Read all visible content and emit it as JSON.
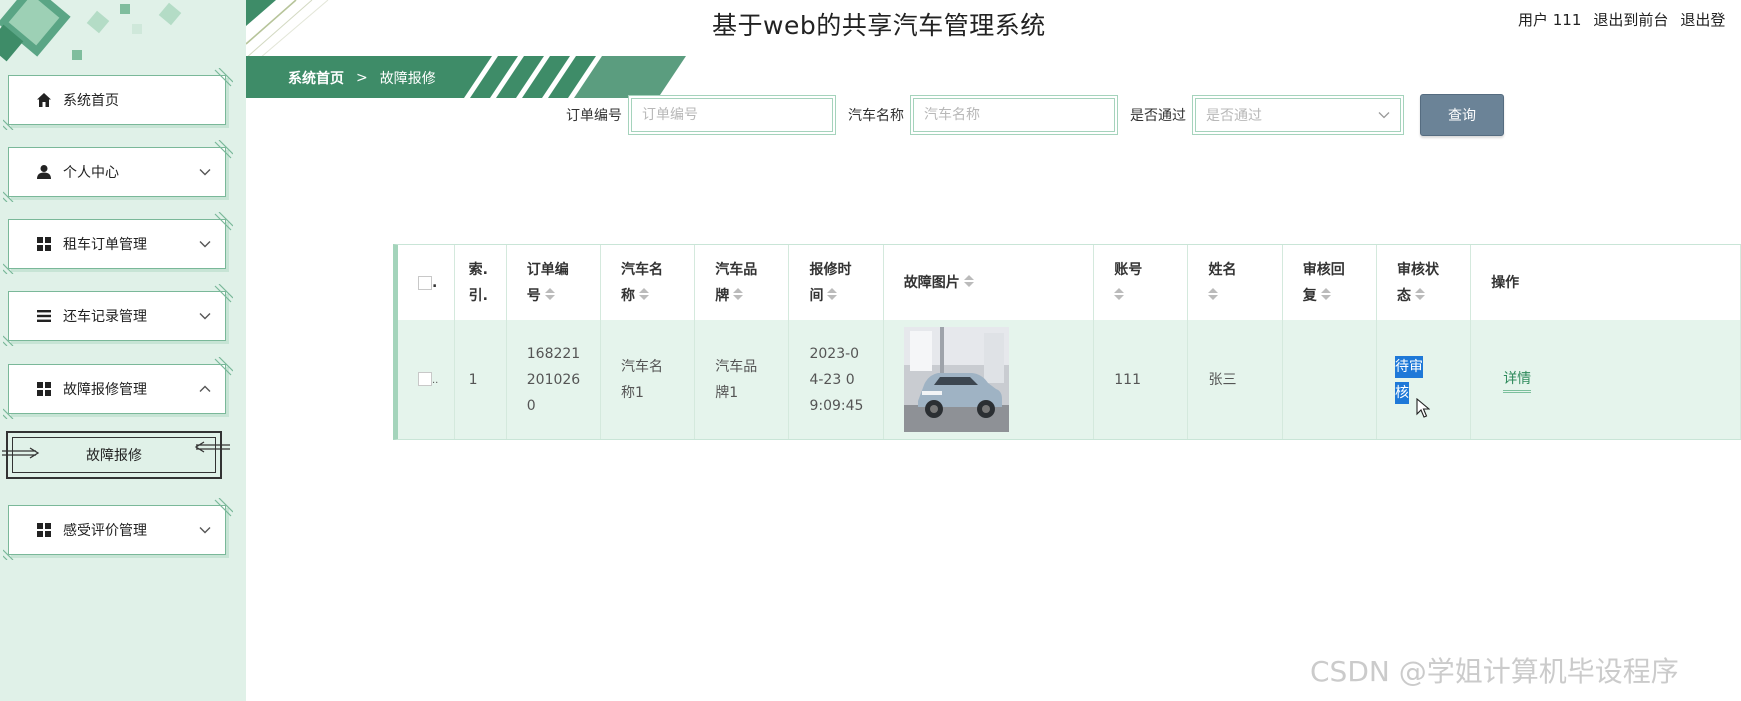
{
  "header": {
    "title": "基于web的共享汽车管理系统",
    "user_label": "用户 111",
    "to_front_label": "退出到前台",
    "logout_label": "退出登"
  },
  "breadcrumb": {
    "home": "系统首页",
    "separator": ">",
    "current": "故障报修"
  },
  "sidebar": {
    "items": [
      {
        "label": "系统首页",
        "icon": "home-icon"
      },
      {
        "label": "个人中心",
        "icon": "user-icon"
      },
      {
        "label": "租车订单管理",
        "icon": "grid-icon"
      },
      {
        "label": "还车记录管理",
        "icon": "list-icon"
      },
      {
        "label": "故障报修管理",
        "icon": "grid-icon"
      },
      {
        "label": "感受评价管理",
        "icon": "grid-icon"
      }
    ],
    "active_sub": "故障报修"
  },
  "search": {
    "order_label": "订单编号",
    "order_placeholder": "订单编号",
    "car_label": "汽车名称",
    "car_placeholder": "汽车名称",
    "pass_label": "是否通过",
    "pass_placeholder": "是否通过",
    "query_button": "查询"
  },
  "table": {
    "headers": {
      "index_1": "索.",
      "index_2": "引.",
      "order_1": "订单编",
      "order_2": "号",
      "car_1": "汽车名",
      "car_2": "称",
      "brand_1": "汽车品",
      "brand_2": "牌",
      "time_1": "报修时",
      "time_2": "间",
      "image": "故障图片",
      "account_1": "账号",
      "name_1": "姓名",
      "reply_1": "审核回",
      "reply_2": "复",
      "status_1": "审核状",
      "status_2": "态",
      "actions": "操作"
    },
    "rows": [
      {
        "index": "1",
        "order_1": "168221",
        "order_2": "201026",
        "order_3": "0",
        "car_1": "汽车名",
        "car_2": "称1",
        "brand_1": "汽车品",
        "brand_2": "牌1",
        "time_1": "2023-0",
        "time_2": "4-23 0",
        "time_3": "9:09:45",
        "account": "111",
        "name": "张三",
        "reply": "",
        "status_1": "待审",
        "status_2": "核",
        "detail": "详情"
      }
    ]
  },
  "watermark": "CSDN @学姐计算机毕设程序",
  "colors": {
    "sidebar_bg": "#e0f1e8",
    "accent_green": "#3e8c68",
    "row_bg": "#e5f4ec",
    "query_btn": "#6b8397",
    "selection": "#1e78d8"
  }
}
